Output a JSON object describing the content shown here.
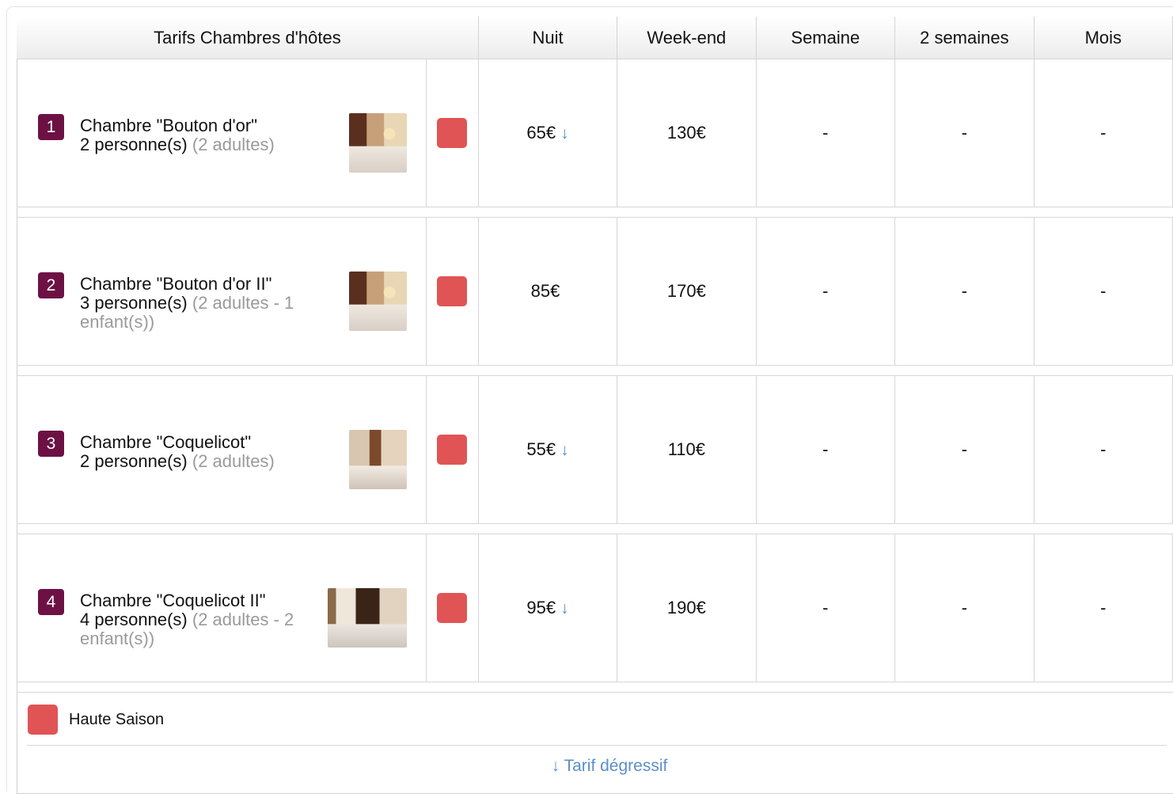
{
  "table": {
    "headers": {
      "rooms": "Tarifs Chambres d'hôtes",
      "night": "Nuit",
      "weekend": "Week-end",
      "week": "Semaine",
      "two_weeks": "2 semaines",
      "month": "Mois"
    },
    "rooms": [
      {
        "number": "1",
        "name": "Chambre \"Bouton d'or\"",
        "capacity": "2 personne(s)",
        "detail": "(2 adultes)",
        "night": "65€",
        "night_arrow": "↓",
        "weekend": "130€",
        "week": "-",
        "two_weeks": "-",
        "month": "-"
      },
      {
        "number": "2",
        "name": "Chambre \"Bouton d'or II\"",
        "capacity": "3 personne(s)",
        "detail": "(2 adultes - 1 enfant(s))",
        "night": "85€",
        "night_arrow": "",
        "weekend": "170€",
        "week": "-",
        "two_weeks": "-",
        "month": "-"
      },
      {
        "number": "3",
        "name": "Chambre \"Coquelicot\"",
        "capacity": "2 personne(s)",
        "detail": "(2 adultes)",
        "night": "55€",
        "night_arrow": "↓",
        "weekend": "110€",
        "week": "-",
        "two_weeks": "-",
        "month": "-"
      },
      {
        "number": "4",
        "name": "Chambre \"Coquelicot II\"",
        "capacity": "4 personne(s)",
        "detail": "(2 adultes - 2 enfant(s))",
        "night": "95€",
        "night_arrow": "↓",
        "weekend": "190€",
        "week": "-",
        "two_weeks": "-",
        "month": "-"
      }
    ]
  },
  "legend": {
    "season_label": "Haute Saison",
    "season_color": "#e05455"
  },
  "footnote": "↓ Tarif dégressif",
  "colors": {
    "badge": "#6d1144",
    "link": "#5b8fc8"
  }
}
